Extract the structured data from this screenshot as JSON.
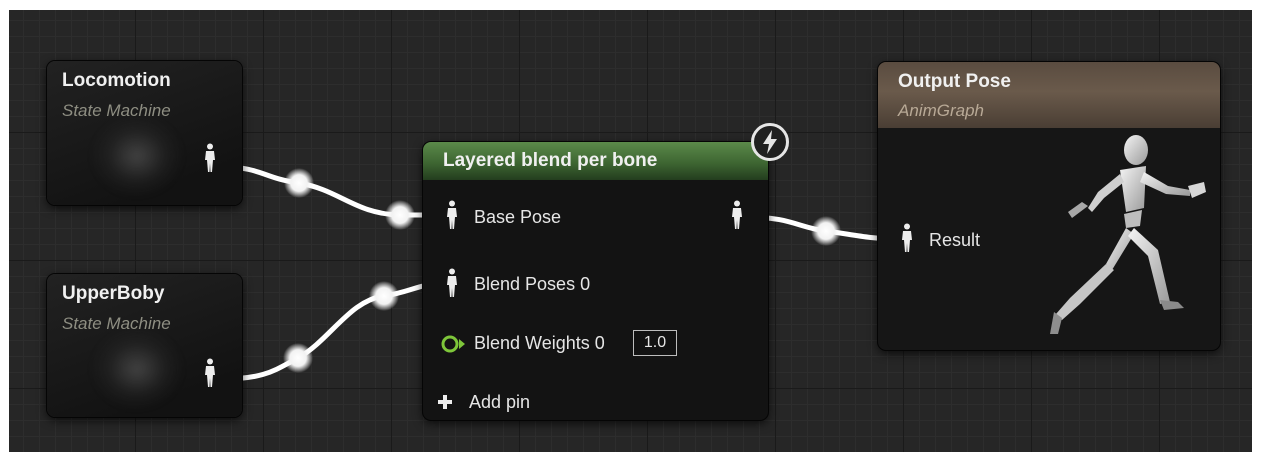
{
  "nodes": {
    "locomotion": {
      "title": "Locomotion",
      "subtitle": "State Machine"
    },
    "upperbody": {
      "title": "UpperBoby",
      "subtitle": "State Machine"
    },
    "blend": {
      "title": "Layered blend per bone",
      "pins": {
        "base_pose": "Base Pose",
        "blend_poses": "Blend Poses 0",
        "blend_weights": "Blend Weights 0",
        "blend_weights_value": "1.0",
        "add_pin": "Add pin"
      }
    },
    "output": {
      "title": "Output Pose",
      "subtitle": "AnimGraph",
      "pins": {
        "result": "Result"
      }
    }
  },
  "icons": {
    "pose_pin": "mannequin-pose-pin-icon",
    "float_pin": "float-pin-icon",
    "fast_path": "lightning-bolt-icon",
    "add": "plus-icon",
    "preview": "mannequin-running-icon"
  },
  "colors": {
    "canvas": "#262626",
    "wire": "#ffffff",
    "blend_header": "#4e7a3f",
    "output_header": "#5e5044",
    "float_pin": "#7ec63a"
  }
}
